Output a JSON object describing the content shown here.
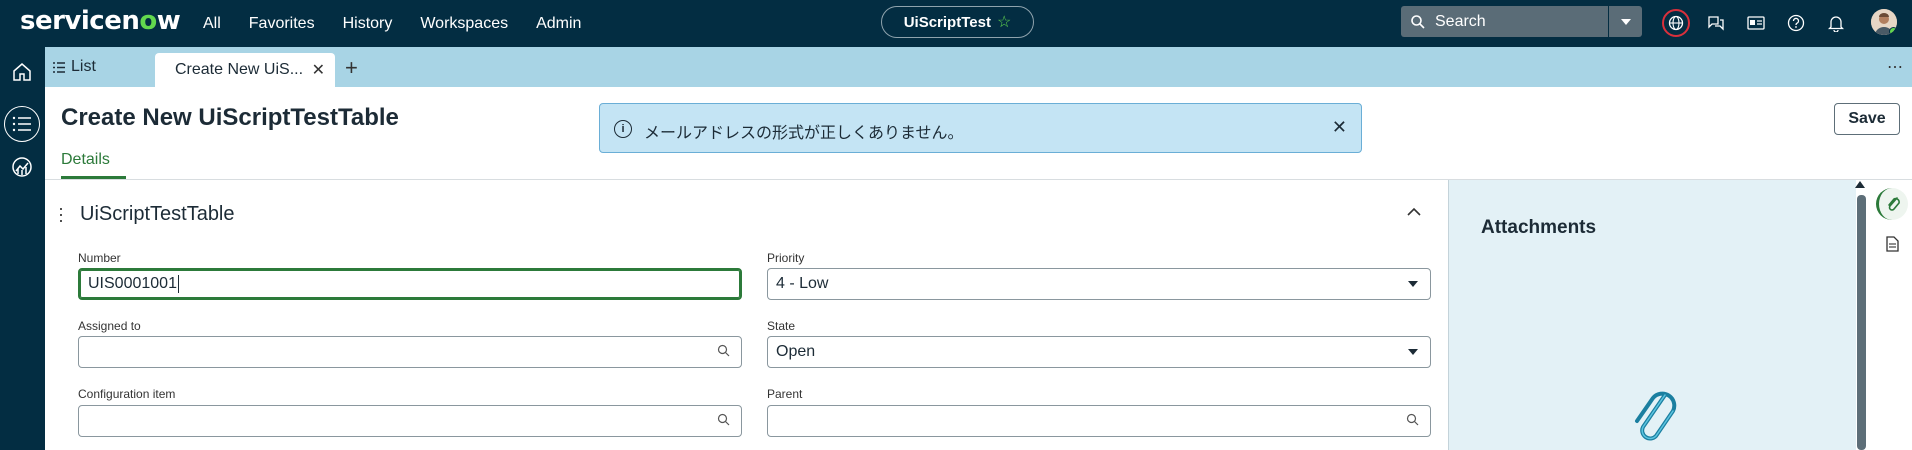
{
  "topnav": {
    "logo_pre": "servicen",
    "logo_o": "o",
    "logo_post": "w",
    "menu": [
      "All",
      "Favorites",
      "History",
      "Workspaces",
      "Admin"
    ],
    "context_label": "UiScriptTest",
    "search_placeholder": "Search",
    "icons": [
      "globe-icon",
      "chat-icon",
      "card-icon",
      "help-icon",
      "bell-icon",
      "avatar"
    ]
  },
  "rail": {
    "items": [
      "home-icon",
      "list-icon",
      "analytics-icon"
    ]
  },
  "tabs": {
    "list_label": "List",
    "active_label": "Create New UiS...",
    "more": "⋯"
  },
  "header": {
    "title": "Create New UiScriptTestTable",
    "details_tab": "Details",
    "save_label": "Save"
  },
  "toast": {
    "message": "メールアドレスの形式が正しくありません。"
  },
  "form": {
    "section_title": "UiScriptTestTable",
    "number_label": "Number",
    "number_value": "UIS0001001",
    "priority_label": "Priority",
    "priority_value": "4 - Low",
    "assigned_label": "Assigned to",
    "assigned_value": "",
    "state_label": "State",
    "state_value": "Open",
    "config_label": "Configuration item",
    "config_value": "",
    "parent_label": "Parent",
    "parent_value": ""
  },
  "attachments": {
    "title": "Attachments"
  },
  "colors": {
    "nav_bg": "#032d42",
    "accent_green": "#62d84e",
    "tab_bar": "#a8d4e5",
    "toast_bg": "#c4e4f4",
    "focus_green": "#2c7a3a",
    "attach_bg": "#e3f1f6"
  }
}
